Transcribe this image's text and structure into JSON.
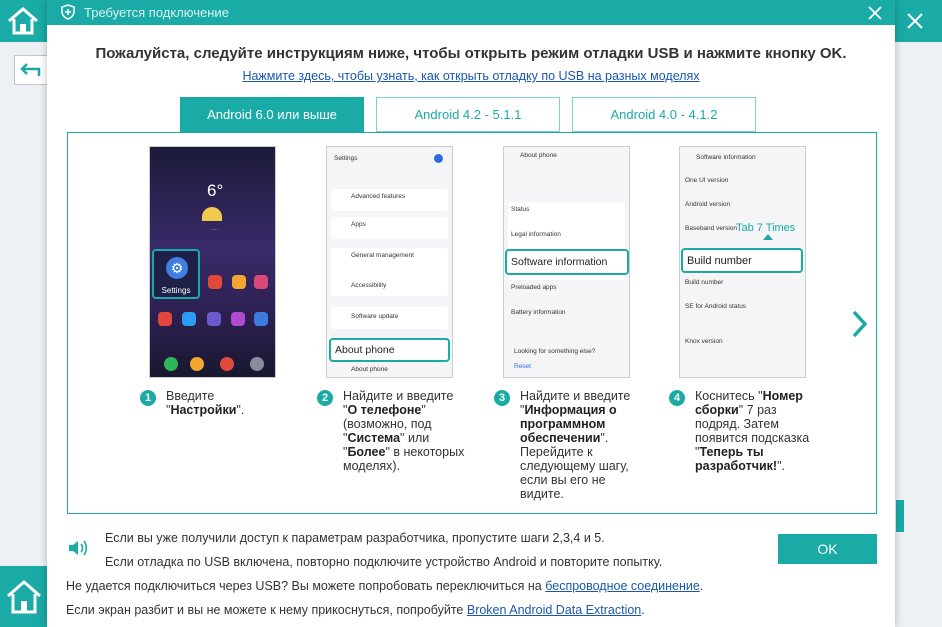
{
  "dialog": {
    "title": "Требуется подключение",
    "heading": "Пожалуйста, следуйте инструкциям ниже, чтобы открыть режим отладки USB и нажмите кнопку OK.",
    "help_link": "Нажмите здесь, чтобы узнать, как открыть отладку по USB на разных моделях"
  },
  "tabs": [
    {
      "label": "Android 6.0 или выше",
      "active": true
    },
    {
      "label": "Android 4.2 - 5.1.1",
      "active": false
    },
    {
      "label": "Android 4.0 - 4.1.2",
      "active": false
    }
  ],
  "screens": {
    "s1": {
      "clock": "6°",
      "settings": "Settings"
    },
    "s2": {
      "title": "Settings",
      "items": [
        "Advanced features",
        "Apps",
        "General management",
        "Accessibility",
        "Software update",
        "About phone"
      ],
      "highlight": "About phone"
    },
    "s3": {
      "title": "About phone",
      "items": [
        "Status",
        "Legal information",
        "Preloaded apps",
        "Battery information",
        "Looking for something else?",
        "Reset"
      ],
      "highlight": "Software information"
    },
    "s4": {
      "title": "Software information",
      "items": [
        "One UI version",
        "Android version",
        "Baseband version",
        "Build number",
        "SE for Android status",
        "Knox version"
      ],
      "highlight": "Build number",
      "hint": "Tab 7 Times"
    }
  },
  "steps": [
    {
      "num": "1",
      "t1": "Введите \"",
      "b1": "Настройки",
      "t2": "\"."
    },
    {
      "num": "2",
      "t1": "Найдите и введите \"",
      "b1": "О телефоне",
      "t2": "\" (возможно, под \"",
      "b2": "Система",
      "t3": "\" или \"",
      "b3": "Более",
      "t4": "\" в некоторых моделях)."
    },
    {
      "num": "3",
      "t1": "Найдите и введите \"",
      "b1": "Информация о программном обеспечении",
      "t2": "\". Перейдите к следующему шагу, если вы его не видите."
    },
    {
      "num": "4",
      "t1": "Коснитесь \"",
      "b1": "Номер сборки",
      "t2": "\" 7 раз подряд. Затем появится подсказка \"",
      "b2": "Теперь ты разработчик!",
      "t3": "\"."
    }
  ],
  "notes": {
    "n1": "Если вы уже получили доступ к параметрам разработчика, пропустите шаги 2,3,4 и 5.",
    "n2": "Если отладка по USB включена, повторно подключите устройство Android и повторите попытку.",
    "n3_text": "Не удается подключиться через USB? Вы можете попробовать переключиться на ",
    "n3_link": "беспроводное соединение",
    "n3_end": ".",
    "n4_text": "Если экран разбит и вы не можете к нему прикоснуться, попробуйте ",
    "n4_link": "Broken Android Data Extraction",
    "n4_end": "."
  },
  "ok_label": "OK",
  "colors": {
    "accent": "#1aaba6",
    "link": "#1a56b0"
  }
}
